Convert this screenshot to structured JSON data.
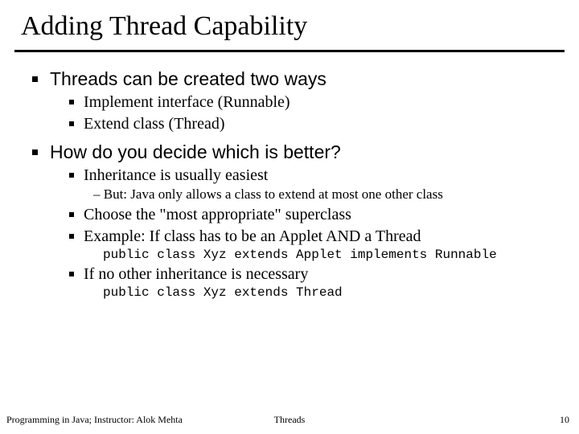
{
  "title": "Adding Thread Capability",
  "section1": {
    "heading": "Threads can be created two ways",
    "items": [
      "Implement interface (Runnable)",
      "Extend class (Thread)"
    ]
  },
  "section2": {
    "heading": "How do you decide which is better?",
    "item1": "Inheritance is usually easiest",
    "item1_sub": "– But: Java only allows a class to extend at most one other class",
    "item2": "Choose the \"most appropriate\" superclass",
    "item3": "Example: If class has to be an Applet AND a Thread",
    "item3_code": "public class Xyz extends Applet implements Runnable",
    "item4": "If no other inheritance is necessary",
    "item4_code": "public class Xyz extends Thread"
  },
  "footer": {
    "left": "Programming in Java; Instructor: Alok Mehta",
    "center": "Threads",
    "right": "10"
  }
}
